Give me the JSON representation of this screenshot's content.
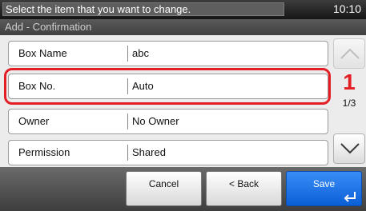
{
  "status": {
    "message": "Select the item that you want to change.",
    "time": "10:10"
  },
  "breadcrumb": "Add - Confirmation",
  "rows": [
    {
      "label": "Box Name",
      "value": "abc"
    },
    {
      "label": "Box No.",
      "value": "Auto"
    },
    {
      "label": "Owner",
      "value": "No Owner"
    },
    {
      "label": "Permission",
      "value": "Shared"
    }
  ],
  "pagination": {
    "indicator": "1/3"
  },
  "callout": {
    "step": "1",
    "color": "#e31e24"
  },
  "actions": {
    "cancel": "Cancel",
    "back": "< Back",
    "save": "Save"
  },
  "icons": {
    "scroll_up": "chevron-up-icon",
    "scroll_down": "chevron-down-icon",
    "save": "enter-icon"
  },
  "colors": {
    "accent": "#0b5fd6",
    "highlight": "#e31e24"
  }
}
